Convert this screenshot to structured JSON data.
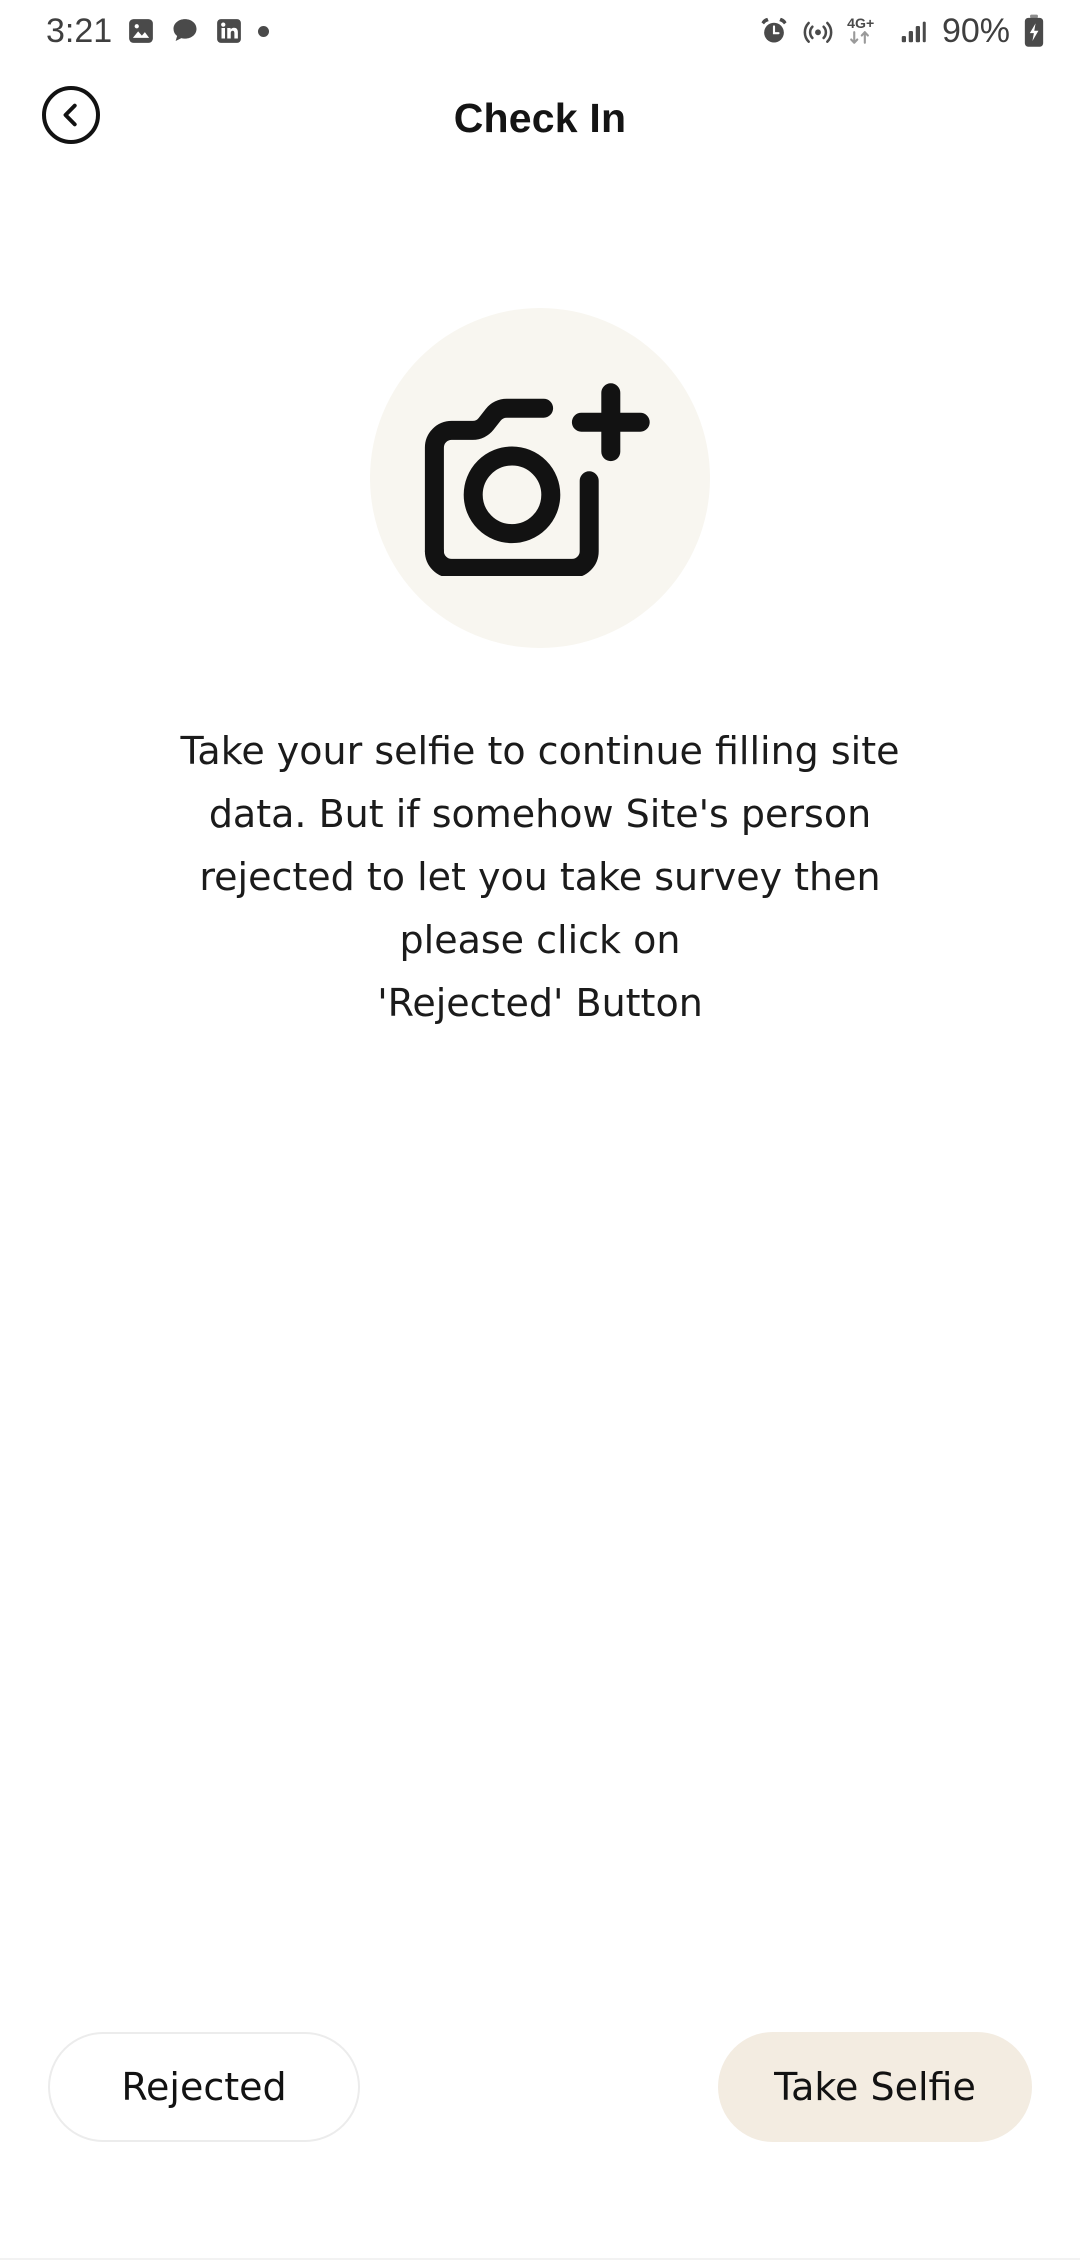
{
  "status_bar": {
    "time": "3:21",
    "battery_percent": "90%",
    "left_icons": [
      "photos-icon",
      "chat-bubble-icon",
      "linkedin-icon",
      "dot-icon"
    ],
    "right_icons": [
      "alarm-icon",
      "hotspot-icon",
      "network-4gplus-icon",
      "signal-bars-icon",
      "battery-charging-icon"
    ],
    "network_label": "4G+"
  },
  "header": {
    "title": "Check In",
    "back_icon": "chevron-left-icon"
  },
  "main": {
    "avatar_icon": "camera-add-icon",
    "avatar_bg": "#F8F6F0",
    "description_lines": [
      "Take your selfie to continue filling site",
      "data. But if somehow Site's person",
      "rejected to let you take survey then",
      "please click on",
      "'Rejected' Button"
    ]
  },
  "actions": {
    "rejected_label": "Rejected",
    "take_selfie_label": "Take Selfie",
    "primary_color": "#F3ECE1",
    "secondary_border": "#ECECEC"
  }
}
